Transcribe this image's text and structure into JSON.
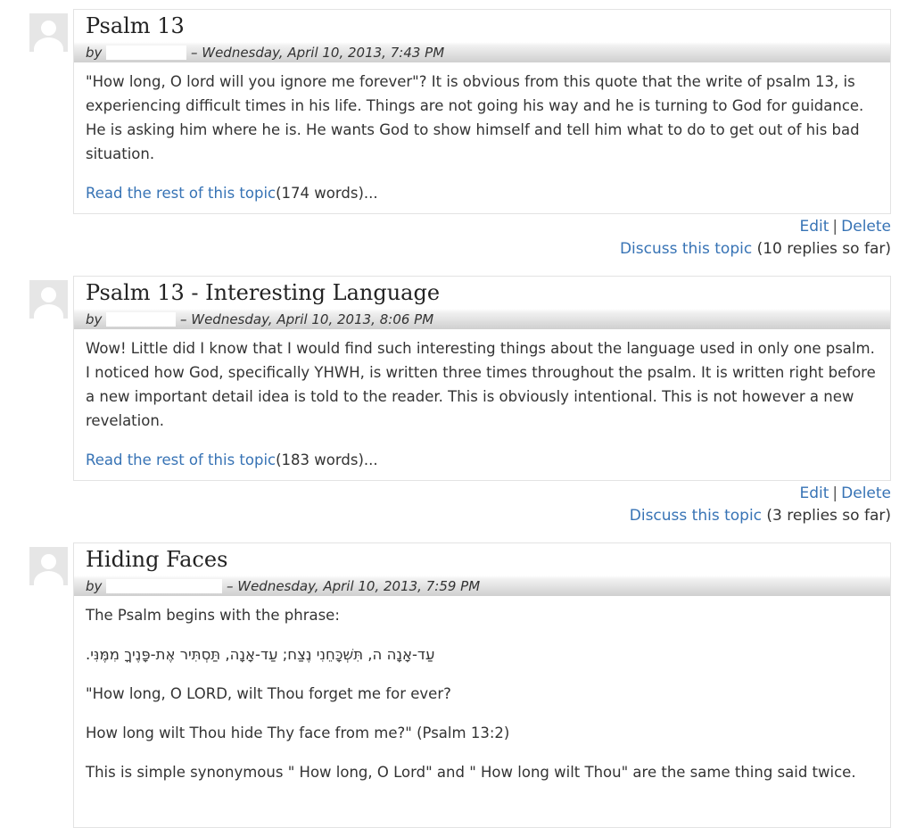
{
  "posts": [
    {
      "title": "Psalm 13",
      "by": "by",
      "date": "– Wednesday, April 10, 2013, 7:43 PM",
      "paragraphs": [
        "\"How long, O lord will you ignore me forever\"? It is obvious from this quote that the write of psalm 13, is experiencing difficult times in his life. Things are not going his way and he is turning to God for guidance. He is asking him where he is. He wants God to show himself and tell him what to do to get out of his bad situation."
      ],
      "read_more": "Read the rest of this topic",
      "word_count": "(174 words)...",
      "edit": "Edit",
      "delete": "Delete",
      "discuss": "Discuss this topic",
      "replies": "(10 replies so far)"
    },
    {
      "title": "Psalm 13 - Interesting Language",
      "by": "by",
      "date": "– Wednesday, April 10, 2013, 8:06 PM",
      "paragraphs": [
        "Wow! Little did I know that I would find such interesting things about the language used in only one psalm. I noticed how God, specifically YHWH, is written three times throughout the psalm. It is written right before a new important detail idea is told to the reader. This is obviously intentional. This is not however a new revelation."
      ],
      "read_more": "Read the rest of this topic",
      "word_count": "(183 words)...",
      "edit": "Edit",
      "delete": "Delete",
      "discuss": "Discuss this topic",
      "replies": "(3 replies so far)"
    },
    {
      "title": "Hiding Faces",
      "by": "by",
      "date": "– Wednesday, April 10, 2013, 7:59 PM",
      "paragraphs": [
        "The Psalm begins with the phrase:",
        "עַד-אָנָה ה, תִּשְׁכָּחֵנִי נֶצַח;     עַד-אָנָה, תַּסְתִּיר אֶת-פָּנֶיךָ מִמֶּנִּי.",
        "\"How long, O LORD, wilt Thou forget me for ever?",
        "How long wilt Thou hide Thy face from me?\" (Psalm 13:2)",
        "This is simple synonymous \" How long, O Lord\" and \" How long wilt Thou\" are the same thing said twice."
      ]
    }
  ]
}
